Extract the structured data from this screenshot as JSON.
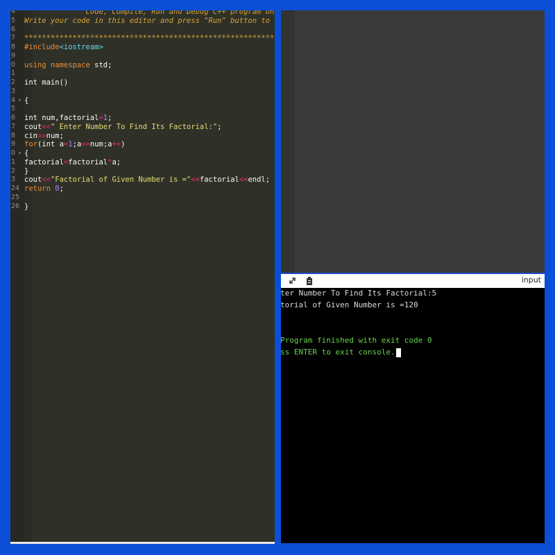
{
  "editor": {
    "lines": [
      {
        "n": "4",
        "text": "              Code, Compile, Run and Debug C++ program online.",
        "cls": "cmt"
      },
      {
        "n": "5",
        "text": "Write your code in this editor and press \"Run\" button to compile and execute it.",
        "cls": "cmt"
      },
      {
        "n": "6",
        "text": "",
        "cls": ""
      },
      {
        "n": "7",
        "text": "*******************************************************************************",
        "cls": "cmt"
      },
      {
        "n": "8",
        "text": "",
        "cls": ""
      },
      {
        "n": "9",
        "text": "",
        "cls": ""
      },
      {
        "n": "0",
        "text": "",
        "cls": ""
      },
      {
        "n": "1",
        "text": "",
        "cls": ""
      },
      {
        "n": "2",
        "text": "",
        "cls": ""
      },
      {
        "n": "3",
        "text": "",
        "cls": ""
      },
      {
        "n": "4",
        "text": "",
        "cls": ""
      },
      {
        "n": "5",
        "text": "",
        "cls": ""
      },
      {
        "n": "6",
        "text": "",
        "cls": ""
      },
      {
        "n": "7",
        "text": "",
        "cls": ""
      },
      {
        "n": "8",
        "text": "",
        "cls": ""
      },
      {
        "n": "9",
        "text": "",
        "cls": ""
      },
      {
        "n": "0",
        "text": "",
        "cls": ""
      },
      {
        "n": "1",
        "text": "",
        "cls": ""
      },
      {
        "n": "2",
        "text": "",
        "cls": ""
      },
      {
        "n": "3",
        "text": "",
        "cls": ""
      },
      {
        "n": "24",
        "text": "",
        "cls": ""
      },
      {
        "n": "25",
        "text": "",
        "cls": ""
      },
      {
        "n": "26",
        "text": "",
        "cls": ""
      }
    ]
  },
  "code": {
    "include": "#include",
    "include_lib": "<iostream>",
    "using": "using namespace",
    "std": " std;",
    "int_main": "int main()",
    "brace_open": "{",
    "decl_a": "int num,factorial",
    "decl_eq": "=",
    "decl_one": "1",
    "decl_end": ";",
    "cout1": "cout",
    "cout1_op": "<<",
    "cout1_str": "\" Enter Number To Find Its Factorial:\"",
    "cout1_end": ";",
    "cin": "cin",
    "cin_op": ">>",
    "cin_end": "num;",
    "for_kw": "for",
    "for_a": "(int a",
    "for_eq": "=",
    "for_one": "1",
    "for_b": ";a",
    "for_le": "<=",
    "for_c": "num;a",
    "for_pp": "++",
    "for_d": ")",
    "brace2": "{",
    "fact_a": "factorial",
    "fact_eq": "=",
    "fact_b": "factorial",
    "fact_mul": "*",
    "fact_c": "a;",
    "brace3": "}",
    "cout2": "cout",
    "cout2_op": "<<",
    "cout2_str": "\"Factorial of Given Number is =\"",
    "cout2_op2": "<<",
    "cout2_b": "factorial",
    "cout2_op3": "<<",
    "cout2_c": "endl;",
    "ret": "return",
    "ret_zero": " 0",
    "ret_end": ";",
    "brace_close": "}"
  },
  "toolbar": {
    "input_label": "input",
    "expand_icon": "expand-icon",
    "copy_icon": "clipboard-icon"
  },
  "console": {
    "line1": "ter Number To Find Its Factorial:5",
    "line2": "torial of Given Number is =120",
    "line3": "Program finished with exit code 0",
    "line4": "ss ENTER to exit console."
  }
}
